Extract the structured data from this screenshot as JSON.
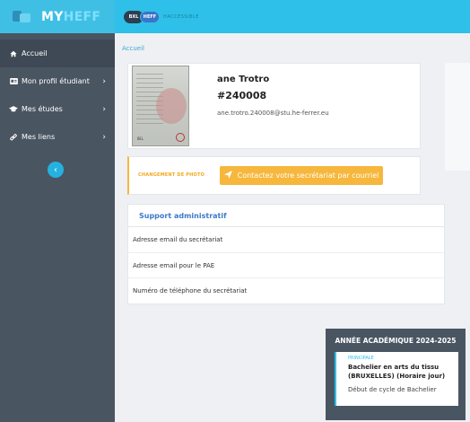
{
  "brand": {
    "part1": "MY",
    "part2": "HEFF"
  },
  "topbar": {
    "badge1": "BXL",
    "badge2": "HEFF",
    "text": "HACCESSIBLE"
  },
  "sidebar": {
    "items": [
      {
        "label": "Accueil",
        "icon": "home-icon"
      },
      {
        "label": "Mon profil étudiant",
        "icon": "id-card-icon"
      },
      {
        "label": "Mes études",
        "icon": "graduation-cap-icon"
      },
      {
        "label": "Mes liens",
        "icon": "link-icon"
      }
    ],
    "collapse_glyph": "‹"
  },
  "breadcrumb": "Accueil",
  "profile": {
    "name": "ane Trotro",
    "number": "#240008",
    "email": "ane.trotro.240008@stu.he-ferrer.eu",
    "photo_code": "BEL"
  },
  "photo_change": {
    "label": "CHANGEMENT DE PHOTO",
    "button": "Contactez votre secrétariat par courriel"
  },
  "support": {
    "title": "Support administratif",
    "rows": [
      "Adresse email du secrétariat",
      "Adresse email pour le PAE",
      "Numéro de téléphone du secrétariat"
    ]
  },
  "academic": {
    "title": "ANNÉE ACADÉMIQUE 2024-2025",
    "tag": "PRINCIPALE",
    "program": "Bachelier en arts du tissu (BRUXELLES) (Horaire jour)",
    "cycle": "Début de cycle de Bachelier"
  },
  "colors": {
    "accent": "#2ec0e8",
    "sidebar": "#4a5562",
    "warning": "#f6b73c",
    "link": "#3b79c9"
  }
}
